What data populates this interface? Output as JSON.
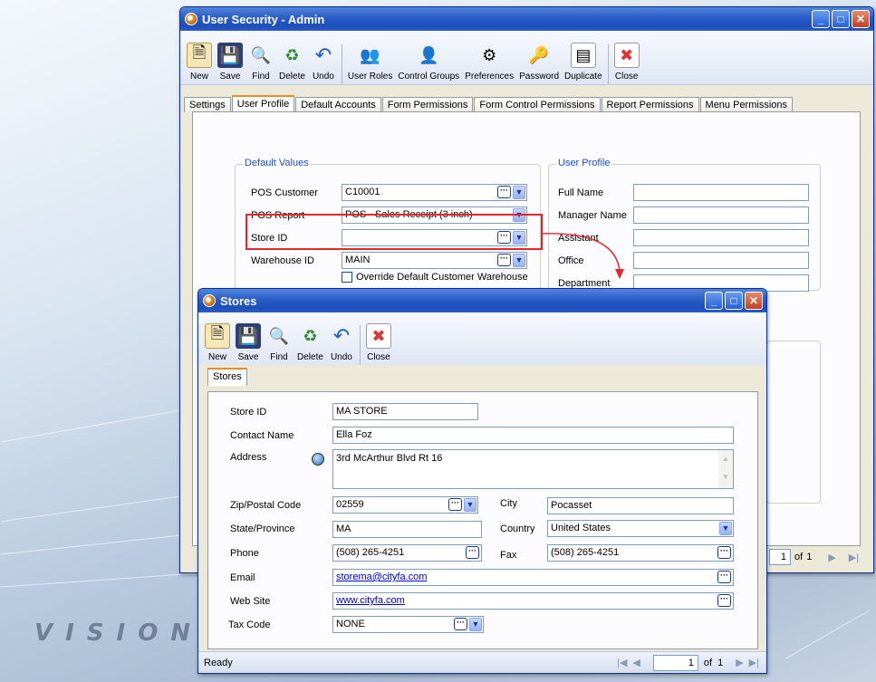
{
  "background": {
    "brand_text": "VISION"
  },
  "main_window": {
    "title": "User Security - Admin",
    "toolbar": [
      "New",
      "Save",
      "Find",
      "Delete",
      "Undo",
      "User Roles",
      "Control Groups",
      "Preferences",
      "Password",
      "Duplicate",
      "Close"
    ],
    "tabs": [
      "Settings",
      "User Profile",
      "Default Accounts",
      "Form Permissions",
      "Form Control Permissions",
      "Report Permissions",
      "Menu Permissions"
    ],
    "active_tab": "User Profile",
    "default_values": {
      "group_title": "Default Values",
      "pos_customer_label": "POS Customer",
      "pos_customer_value": "C10001",
      "pos_report_label": "POS Report",
      "pos_report_value": "POS - Sales Receipt (3 inch)",
      "store_id_label": "Store ID",
      "store_id_value": "",
      "warehouse_id_label": "Warehouse ID",
      "warehouse_id_value": "MAIN",
      "override_label": "Override Default Customer Warehouse",
      "override_checked": false
    },
    "user_profile": {
      "group_title": "User Profile",
      "fields": [
        "Full Name",
        "Manager Name",
        "Assistant",
        "Office",
        "Department"
      ]
    },
    "pager": {
      "page": "1",
      "of_label": "of",
      "total": "1"
    }
  },
  "stores_window": {
    "title": "Stores",
    "toolbar": [
      "New",
      "Save",
      "Find",
      "Delete",
      "Undo",
      "Close"
    ],
    "tab": "Stores",
    "form": {
      "store_id_label": "Store ID",
      "store_id": "MA STORE",
      "contact_name_label": "Contact Name",
      "contact_name": "Ella Foz",
      "address_label": "Address",
      "address": "3rd McArthur Blvd Rt 16",
      "zip_label": "Zip/Postal Code",
      "zip": "02559",
      "city_label": "City",
      "city": "Pocasset",
      "state_label": "State/Province",
      "state": "MA",
      "country_label": "Country",
      "country": "United States",
      "phone_label": "Phone",
      "phone": "(508) 265-4251",
      "fax_label": "Fax",
      "fax": "(508) 265-4251",
      "email_label": "Email",
      "email": "storema@cityfa.com",
      "website_label": "Web Site",
      "website": "www.cityfa.com",
      "taxcode_label": "Tax Code",
      "taxcode": "NONE"
    },
    "status": "Ready",
    "pager": {
      "page": "1",
      "of_label": "of",
      "total": "1"
    }
  },
  "colors": {
    "highlight": "#e3262b",
    "title_blue": "#2a5cc6"
  }
}
